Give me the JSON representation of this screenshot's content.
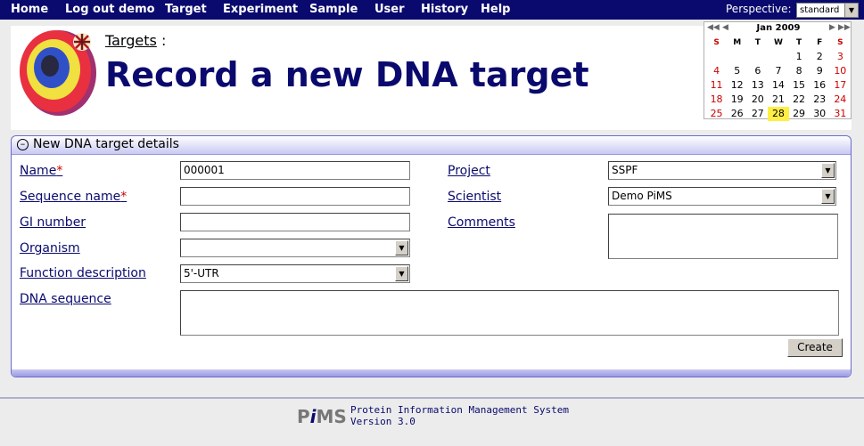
{
  "nav": {
    "items": [
      "Home",
      "Log out demo",
      "Target",
      "Experiment",
      "Sample",
      "User",
      "History",
      "Help"
    ],
    "perspective_label": "Perspective:",
    "perspective_value": "standard"
  },
  "header": {
    "breadcrumb_link": "Targets",
    "breadcrumb_sep": ":",
    "title": "Record a new DNA target"
  },
  "calendar": {
    "month": "Jan 2009",
    "days_of_week": [
      "S",
      "M",
      "T",
      "W",
      "T",
      "F",
      "S"
    ],
    "weeks": [
      [
        "",
        "",
        "",
        "",
        "1",
        "2",
        "3"
      ],
      [
        "4",
        "5",
        "6",
        "7",
        "8",
        "9",
        "10"
      ],
      [
        "11",
        "12",
        "13",
        "14",
        "15",
        "16",
        "17"
      ],
      [
        "18",
        "19",
        "20",
        "21",
        "22",
        "23",
        "24"
      ],
      [
        "25",
        "26",
        "27",
        "28",
        "29",
        "30",
        "31"
      ]
    ],
    "today": "28",
    "highlight_color": "#ffee44"
  },
  "form": {
    "panel_title": "New DNA target details",
    "name_label": "Name",
    "name_value": "000001",
    "sequence_name_label": "Sequence name",
    "sequence_name_value": "",
    "gi_number_label": "GI number",
    "gi_number_value": "",
    "organism_label": "Organism",
    "organism_value": "",
    "function_label": "Function description",
    "function_value": "5'-UTR",
    "dna_sequence_label": "DNA sequence",
    "project_label": "Project",
    "project_value": "SSPF",
    "scientist_label": "Scientist",
    "scientist_value": "Demo PiMS",
    "comments_label": "Comments",
    "required_mark": "*",
    "create_label": "Create"
  },
  "footer": {
    "logo_text_p": "P",
    "logo_text_i": "i",
    "logo_text_ms": "MS",
    "line1": "Protein Information Management System",
    "line2": "Version 3.0"
  },
  "colors": {
    "nav_bg": "#0a0a6e",
    "title": "#0a0a6e",
    "required": "#cc0000",
    "panel_border": "#6b6bd0"
  }
}
